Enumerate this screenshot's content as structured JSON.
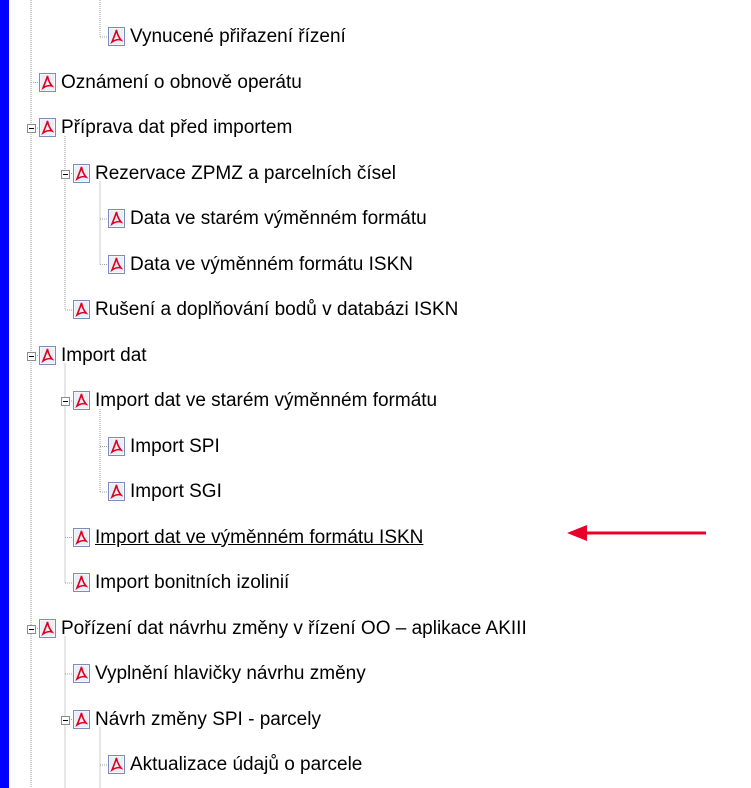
{
  "tree": {
    "items": [
      {
        "label": "Vynucené přiřazení řízení",
        "level": 2,
        "expandable": false
      },
      {
        "label": "Oznámení o obnově operátu",
        "level": 0,
        "expandable": false
      },
      {
        "label": "Příprava dat před importem",
        "level": 0,
        "expandable": true
      },
      {
        "label": "Rezervace ZPMZ a parcelních čísel",
        "level": 1,
        "expandable": true
      },
      {
        "label": "Data ve starém výměnném formátu",
        "level": 2,
        "expandable": false
      },
      {
        "label": "Data ve výměnném formátu ISKN",
        "level": 2,
        "expandable": false
      },
      {
        "label": "Rušení  a doplňování bodů v databázi ISKN",
        "level": 1,
        "expandable": false
      },
      {
        "label": "Import dat",
        "level": 0,
        "expandable": true
      },
      {
        "label": "Import dat ve starém výměnném formátu",
        "level": 1,
        "expandable": true
      },
      {
        "label": "Import SPI",
        "level": 2,
        "expandable": false
      },
      {
        "label": "Import SGI",
        "level": 2,
        "expandable": false
      },
      {
        "label": "Import dat ve výměnném formátu ISKN",
        "level": 1,
        "expandable": false,
        "highlighted": true
      },
      {
        "label": "Import bonitních izolinií",
        "level": 1,
        "expandable": false
      },
      {
        "label": "Pořízení dat návrhu změny v řízení OO – aplikace AKIII",
        "level": 0,
        "expandable": true
      },
      {
        "label": "Vyplnění hlavičky návrhu změny",
        "level": 1,
        "expandable": false
      },
      {
        "label": "Návrh změny SPI - parcely",
        "level": 1,
        "expandable": true
      },
      {
        "label": "Aktualizace údajů o parcele",
        "level": 2,
        "expandable": false
      }
    ]
  },
  "icons": {
    "document": "pdf-icon",
    "toggle": "collapse-toggle-icon",
    "pointer": "arrow-icon"
  },
  "colors": {
    "background": "#0000ff",
    "panel": "#ffffff",
    "arrow": "#e8002a",
    "pdf_red": "#e0001b",
    "tree_line": "#a0a0a0"
  }
}
